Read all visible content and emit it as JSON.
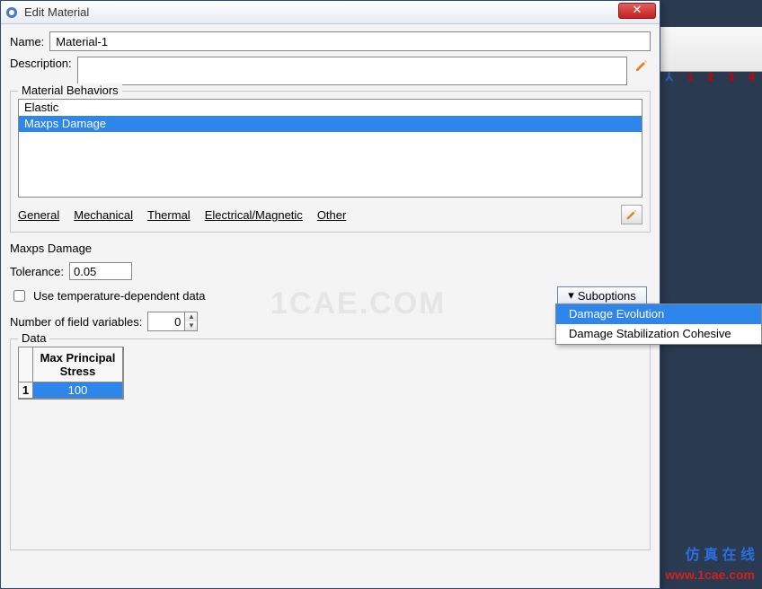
{
  "window": {
    "title": "Edit Material"
  },
  "form": {
    "name_label": "Name:",
    "name_value": "Material-1",
    "desc_label": "Description:",
    "desc_value": ""
  },
  "behaviors": {
    "legend": "Material Behaviors",
    "items": [
      "Elastic",
      "Maxps Damage"
    ],
    "selected_index": 1
  },
  "categories": {
    "general": "General",
    "mechanical": "Mechanical",
    "thermal": "Thermal",
    "electrical": "Electrical/Magnetic",
    "other": "Other"
  },
  "maxps": {
    "title": "Maxps Damage",
    "tolerance_label": "Tolerance:",
    "tolerance_value": "0.05",
    "suboptions_label": "Suboptions",
    "use_temp_label": "Use temperature-dependent data",
    "use_temp_checked": false,
    "nfv_label": "Number of field variables:",
    "nfv_value": "0"
  },
  "submenu": {
    "items": [
      "Damage Evolution",
      "Damage Stabilization Cohesive"
    ],
    "selected_index": 0
  },
  "data_section": {
    "legend": "Data",
    "header": "Max Principal Stress",
    "rows": [
      {
        "idx": "1",
        "value": "100"
      }
    ]
  },
  "toolbar": {
    "nums": "1   2   3   4"
  },
  "watermark": {
    "center": "1CAE.COM",
    "cn": "仿 真 在 线",
    "url": "www.1cae.com"
  }
}
